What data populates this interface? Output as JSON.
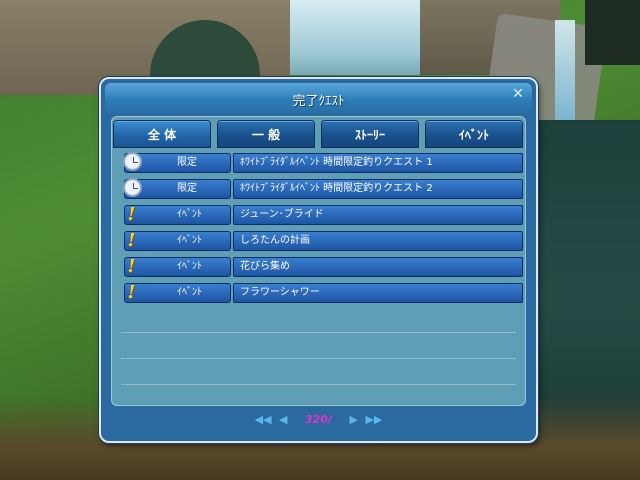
{
  "window": {
    "title": "完了ｸｴｽﾄ",
    "close_label": "✕"
  },
  "tabs": [
    {
      "label": "全 体",
      "active": true
    },
    {
      "label": "一 般",
      "active": false
    },
    {
      "label": "ｽﾄｰﾘｰ",
      "active": false
    },
    {
      "label": "ｲﾍﾞﾝﾄ",
      "active": false
    }
  ],
  "quests": [
    {
      "icon": "clock-icon",
      "category": "限定",
      "name": "ﾎﾜｲﾄﾌﾞﾗｲﾀﾞﾙｲﾍﾞﾝﾄ 時間限定釣りクエスト 1"
    },
    {
      "icon": "clock-icon",
      "category": "限定",
      "name": "ﾎﾜｲﾄﾌﾞﾗｲﾀﾞﾙｲﾍﾞﾝﾄ 時間限定釣りクエスト 2"
    },
    {
      "icon": "exclamation-icon",
      "category": "ｲﾍﾞﾝﾄ",
      "name": "ジューン･ブライド"
    },
    {
      "icon": "exclamation-icon",
      "category": "ｲﾍﾞﾝﾄ",
      "name": "しろたんの計画"
    },
    {
      "icon": "exclamation-icon",
      "category": "ｲﾍﾞﾝﾄ",
      "name": "花びら集め"
    },
    {
      "icon": "exclamation-icon",
      "category": "ｲﾍﾞﾝﾄ",
      "name": "フラワーシャワー"
    }
  ],
  "pager": {
    "first": "◀◀",
    "prev": "◀",
    "page_text": "320/",
    "next": "▶",
    "last": "▶▶"
  }
}
